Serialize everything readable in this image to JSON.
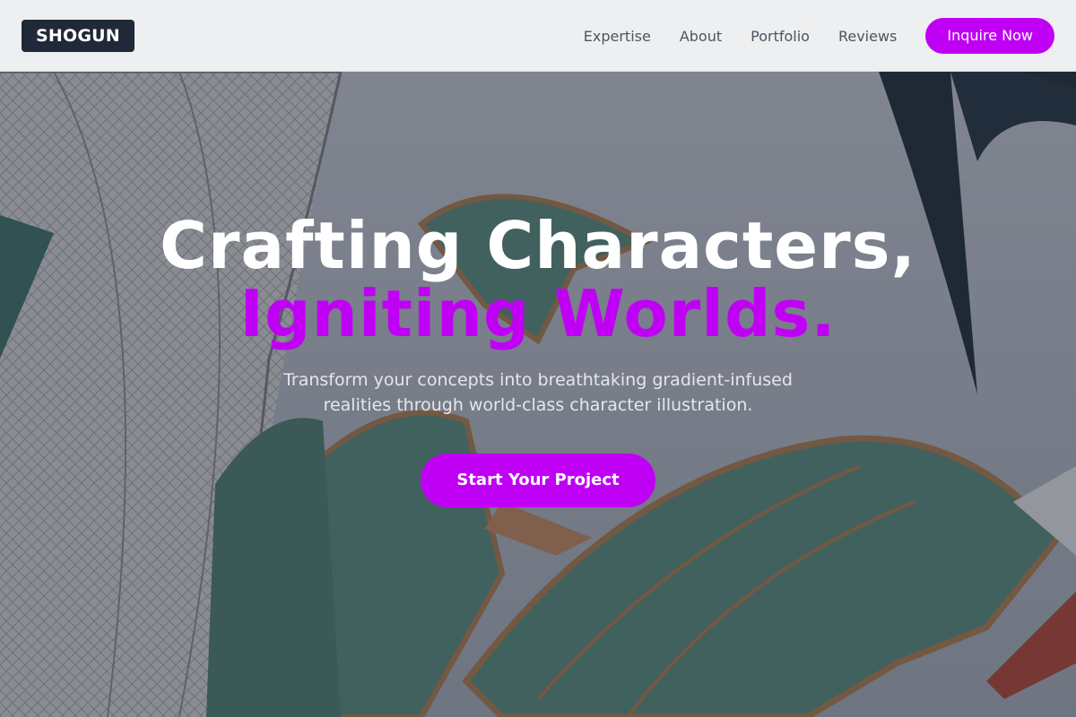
{
  "header": {
    "logo": "SHOGUN",
    "nav": [
      "Expertise",
      "About",
      "Portfolio",
      "Reviews"
    ],
    "cta_label": "Inquire Now"
  },
  "hero": {
    "headline_line1": "Crafting Characters,",
    "headline_line2": "Igniting Worlds.",
    "subtitle": "Transform your concepts into breathtaking gradient-infused realities through world-class character illustration.",
    "cta_label": "Start Your Project"
  },
  "colors": {
    "accent": "#c000f5",
    "logo_bg": "#1f2937",
    "header_bg": "#f3f4f6",
    "nav_text": "#4b5563"
  }
}
